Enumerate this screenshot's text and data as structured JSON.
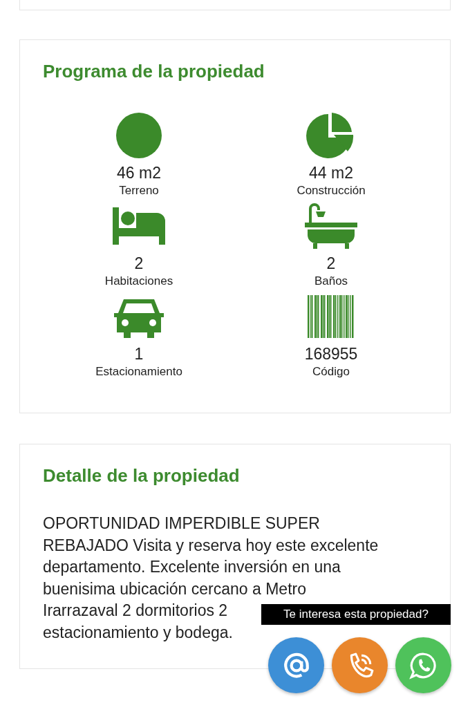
{
  "programa": {
    "title": "Programa de la propiedad",
    "features": [
      {
        "kind": "area",
        "value": "46 m2",
        "label": "Terreno"
      },
      {
        "kind": "pie",
        "value": "44 m2",
        "label": "Construcción"
      },
      {
        "kind": "bed",
        "value": "2",
        "label": "Habitaciones"
      },
      {
        "kind": "bath",
        "value": "2",
        "label": "Baños"
      },
      {
        "kind": "car",
        "value": "1",
        "label": "Estacionamiento"
      },
      {
        "kind": "barcode",
        "value": "168955",
        "label": "Código"
      }
    ]
  },
  "detalle": {
    "title": "Detalle de la propiedad",
    "lines": [
      "OPORTUNIDAD IMPERDIBLE SUPER",
      "REBAJADO Visita y reserva hoy este excelente",
      "departamento. Excelente inversión en una",
      "buenisima ubicación cercano a Metro",
      "Irarrazaval 2 dormitorios 2",
      "estacionamiento y bodega."
    ]
  },
  "contact": {
    "tooltip": "Te interesa esta propiedad?",
    "buttons": [
      {
        "kind": "email",
        "color": "#3d8fd6"
      },
      {
        "kind": "phone",
        "color": "#e9862c"
      },
      {
        "kind": "whatsapp",
        "color": "#4fc25b"
      }
    ]
  }
}
